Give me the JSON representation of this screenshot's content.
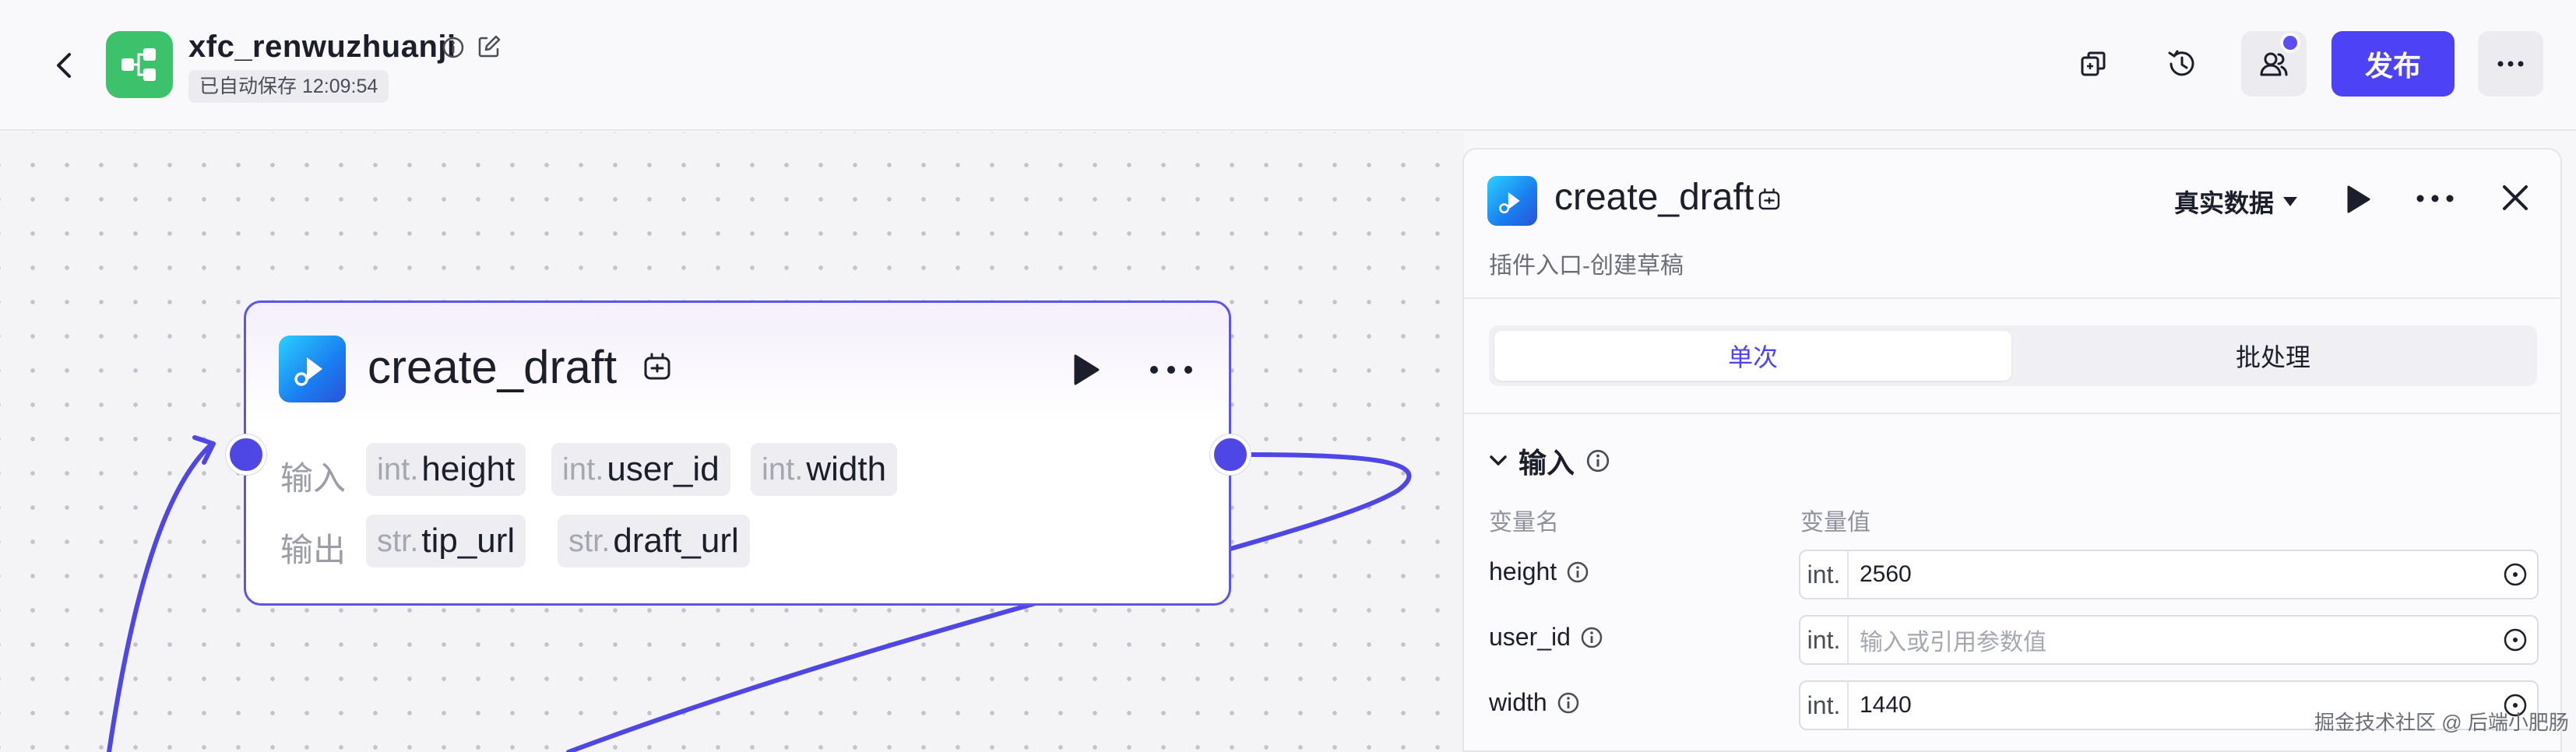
{
  "header": {
    "app_name": "xfc_renwuzhuanji",
    "save_status": "已自动保存 12:09:54",
    "publish_label": "发布",
    "icons": [
      "back-icon",
      "workflow-icon",
      "info-icon",
      "edit-icon",
      "copy-icon",
      "history-icon",
      "collaborators-icon",
      "more-icon"
    ]
  },
  "node": {
    "title": "create_draft",
    "input_label": "输入",
    "output_label": "输出",
    "inputs": [
      {
        "type": "int.",
        "name": "height"
      },
      {
        "type": "int.",
        "name": "user_id"
      },
      {
        "type": "int.",
        "name": "width"
      }
    ],
    "outputs": [
      {
        "type": "str.",
        "name": "tip_url"
      },
      {
        "type": "str.",
        "name": "draft_url"
      }
    ]
  },
  "panel": {
    "title": "create_draft",
    "subtitle": "插件入口-创建草稿",
    "data_mode": "真实数据",
    "tabs": [
      "单次",
      "批处理"
    ],
    "active_tab": "单次",
    "section_title": "输入",
    "col_name": "变量名",
    "col_value": "变量值",
    "vars": [
      {
        "name": "height",
        "type": "int.",
        "value": "2560",
        "placeholder": ""
      },
      {
        "name": "user_id",
        "type": "int.",
        "value": "",
        "placeholder": "输入或引用参数值"
      },
      {
        "name": "width",
        "type": "int.",
        "value": "1440",
        "placeholder": ""
      }
    ]
  },
  "watermark": "掘金技术社区 @ 后端小肥肠",
  "colors": {
    "accent": "#4d42f5",
    "edge": "#4e46e5",
    "node_border": "#5d55e8",
    "logo_green": "#3cc26a"
  }
}
